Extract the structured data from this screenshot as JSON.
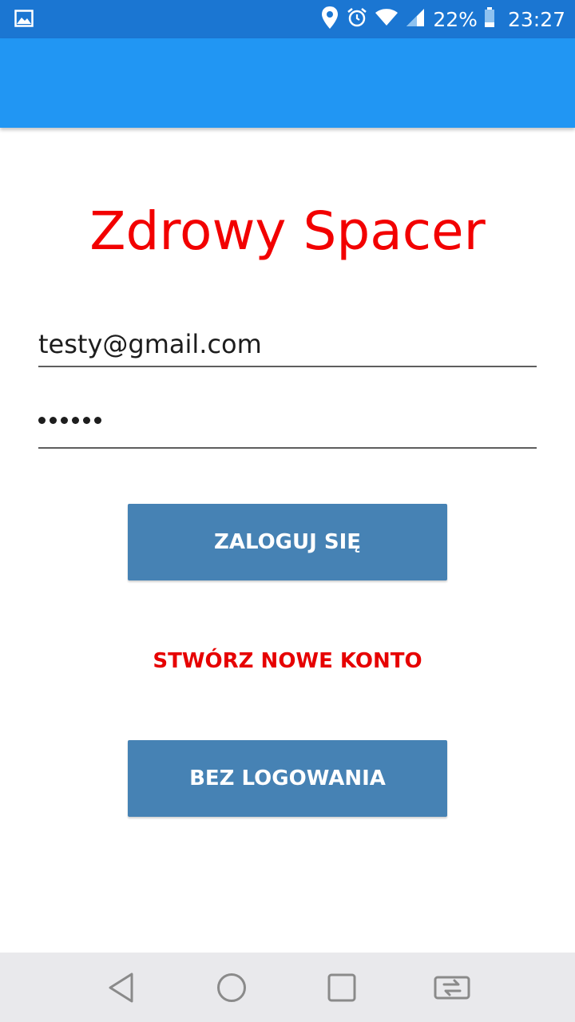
{
  "status_bar": {
    "notification_icon": "image-icon",
    "icons": [
      "location-icon",
      "alarm-icon",
      "wifi-icon",
      "signal-icon"
    ],
    "battery_percent": "22%",
    "battery_icon": "battery-icon",
    "time": "23:27"
  },
  "app_bar": {
    "color": "#2196f3"
  },
  "login": {
    "title": "Zdrowy Spacer",
    "title_color": "#f20000",
    "email_value": "testy@gmail.com",
    "password_length": 6,
    "login_button_label": "ZALOGUJ SIĘ",
    "create_account_link": "STWÓRZ NOWE KONTO",
    "guest_button_label": "BEZ LOGOWANIA",
    "button_color": "#4682b4",
    "link_color": "#e60000"
  },
  "nav_bar": {
    "buttons": [
      "back-icon",
      "home-icon",
      "recent-apps-icon",
      "switch-apps-icon"
    ]
  }
}
